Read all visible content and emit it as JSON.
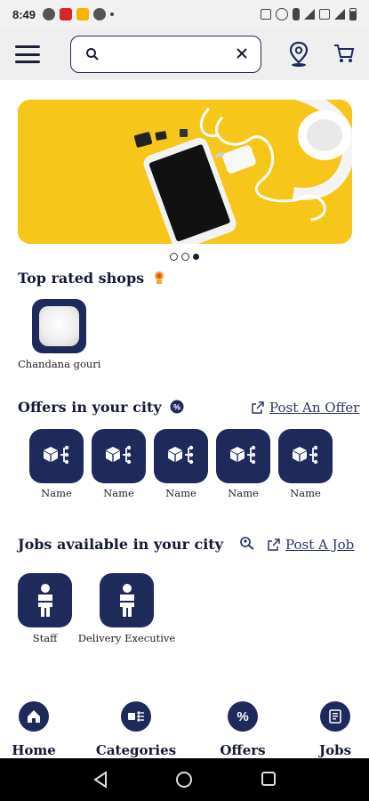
{
  "status_bar": {
    "time": "8:49"
  },
  "search": {
    "placeholder": "",
    "value": ""
  },
  "banner": {
    "image": "phone-charger-headphones-on-yellow-banner",
    "slide_count": 3,
    "active_slide": 3
  },
  "top_rated": {
    "title": "Top rated shops",
    "shops": [
      {
        "name": "Chandana gouri"
      }
    ]
  },
  "offers": {
    "title": "Offers in your city",
    "action": "Post An Offer",
    "items": [
      {
        "name": "Name"
      },
      {
        "name": "Name"
      },
      {
        "name": "Name"
      },
      {
        "name": "Name"
      },
      {
        "name": "Name"
      }
    ]
  },
  "jobs": {
    "title": "Jobs available in your city",
    "action": "Post A Job",
    "items": [
      {
        "name": "Staff"
      },
      {
        "name": "Delivery Executive"
      }
    ]
  },
  "bottom_nav": {
    "items": [
      {
        "label": "Home",
        "icon": "home-icon"
      },
      {
        "label": "Categories",
        "icon": "categories-icon"
      },
      {
        "label": "Offers",
        "icon": "percent-icon"
      },
      {
        "label": "Jobs",
        "icon": "jobs-icon"
      }
    ]
  },
  "colors": {
    "primary": "#1e2a5a",
    "banner": "#f7c61a",
    "appbar": "#efefef"
  }
}
